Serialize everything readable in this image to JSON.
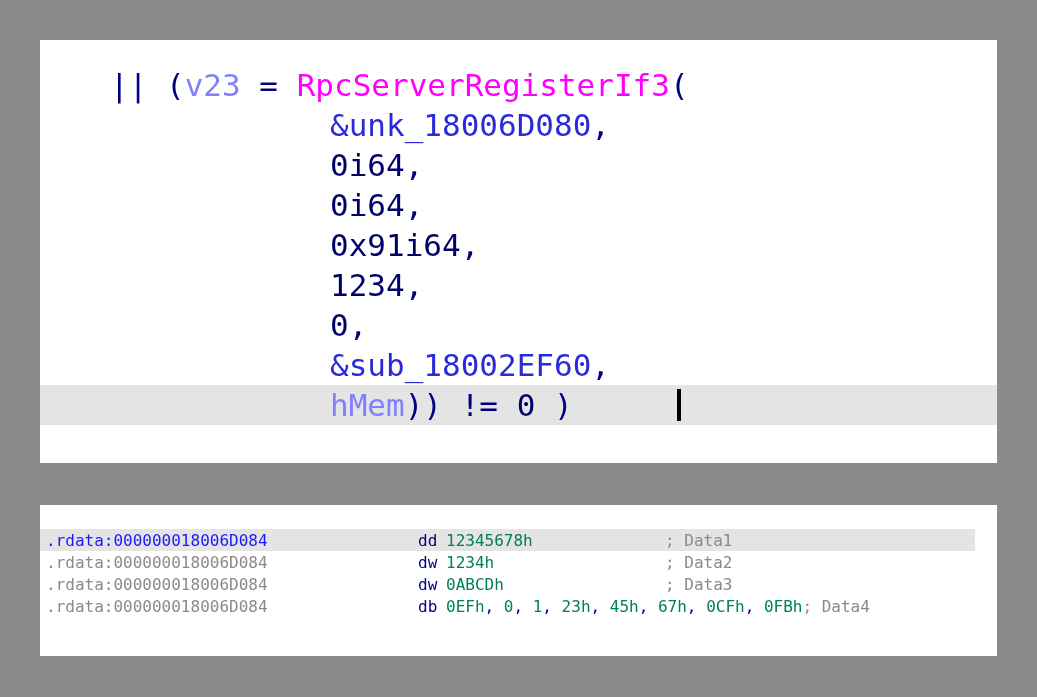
{
  "pseudocode": {
    "lines": [
      {
        "kind": "open",
        "selected": false,
        "cursor": false,
        "tokens": [
          {
            "text": "||",
            "kind": "op"
          },
          {
            "text": " (",
            "kind": "op"
          },
          {
            "text": "v23",
            "kind": "var"
          },
          {
            "text": " = ",
            "kind": "op"
          },
          {
            "text": "RpcServerRegisterIf3",
            "kind": "func"
          },
          {
            "text": "(",
            "kind": "op"
          }
        ]
      },
      {
        "kind": "arg",
        "selected": false,
        "cursor": false,
        "tokens": [
          {
            "text": "&unk_18006D080",
            "kind": "name"
          },
          {
            "text": ",",
            "kind": "op"
          }
        ]
      },
      {
        "kind": "arg",
        "selected": false,
        "cursor": false,
        "tokens": [
          {
            "text": "0i64",
            "kind": "num"
          },
          {
            "text": ",",
            "kind": "op"
          }
        ]
      },
      {
        "kind": "arg",
        "selected": false,
        "cursor": false,
        "tokens": [
          {
            "text": "0i64",
            "kind": "num"
          },
          {
            "text": ",",
            "kind": "op"
          }
        ]
      },
      {
        "kind": "arg",
        "selected": false,
        "cursor": false,
        "tokens": [
          {
            "text": "0x91i64",
            "kind": "num"
          },
          {
            "text": ",",
            "kind": "op"
          }
        ]
      },
      {
        "kind": "arg",
        "selected": false,
        "cursor": false,
        "tokens": [
          {
            "text": "1234",
            "kind": "num"
          },
          {
            "text": ",",
            "kind": "op"
          }
        ]
      },
      {
        "kind": "arg",
        "selected": false,
        "cursor": false,
        "tokens": [
          {
            "text": "0",
            "kind": "num"
          },
          {
            "text": ",",
            "kind": "op"
          }
        ]
      },
      {
        "kind": "arg",
        "selected": false,
        "cursor": false,
        "tokens": [
          {
            "text": "&sub_18002EF60",
            "kind": "name"
          },
          {
            "text": ",",
            "kind": "op"
          }
        ]
      },
      {
        "kind": "arg",
        "selected": true,
        "cursor": true,
        "tokens": [
          {
            "text": "hMem",
            "kind": "var"
          },
          {
            "text": "))",
            "kind": "op"
          },
          {
            "text": " != ",
            "kind": "op"
          },
          {
            "text": "0",
            "kind": "num"
          },
          {
            "text": " )",
            "kind": "op"
          }
        ]
      }
    ]
  },
  "disassembly": {
    "rows": [
      {
        "address": ".rdata:000000018006D084",
        "mnemonic": "dd",
        "selected": true,
        "operands": [
          {
            "text": "12345678h",
            "kind": "num"
          }
        ],
        "comment": "; Data1"
      },
      {
        "address": ".rdata:000000018006D084",
        "mnemonic": "dw",
        "selected": false,
        "operands": [
          {
            "text": "1234h",
            "kind": "num"
          }
        ],
        "comment": "; Data2"
      },
      {
        "address": ".rdata:000000018006D084",
        "mnemonic": "dw",
        "selected": false,
        "operands": [
          {
            "text": "0ABCDh",
            "kind": "num"
          }
        ],
        "comment": "; Data3"
      },
      {
        "address": ".rdata:000000018006D084",
        "mnemonic": "db",
        "selected": false,
        "operands": [
          {
            "text": "0EFh",
            "kind": "num"
          },
          {
            "text": ", ",
            "kind": "op"
          },
          {
            "text": "0",
            "kind": "num"
          },
          {
            "text": ", ",
            "kind": "op"
          },
          {
            "text": "1",
            "kind": "num"
          },
          {
            "text": ", ",
            "kind": "op"
          },
          {
            "text": "23h",
            "kind": "num"
          },
          {
            "text": ", ",
            "kind": "op"
          },
          {
            "text": "45h",
            "kind": "num"
          },
          {
            "text": ", ",
            "kind": "op"
          },
          {
            "text": "67h",
            "kind": "num"
          },
          {
            "text": ", ",
            "kind": "op"
          },
          {
            "text": "0CFh",
            "kind": "num"
          },
          {
            "text": ", ",
            "kind": "op"
          },
          {
            "text": "0FBh",
            "kind": "num"
          }
        ],
        "comment": "; Data4"
      }
    ]
  }
}
